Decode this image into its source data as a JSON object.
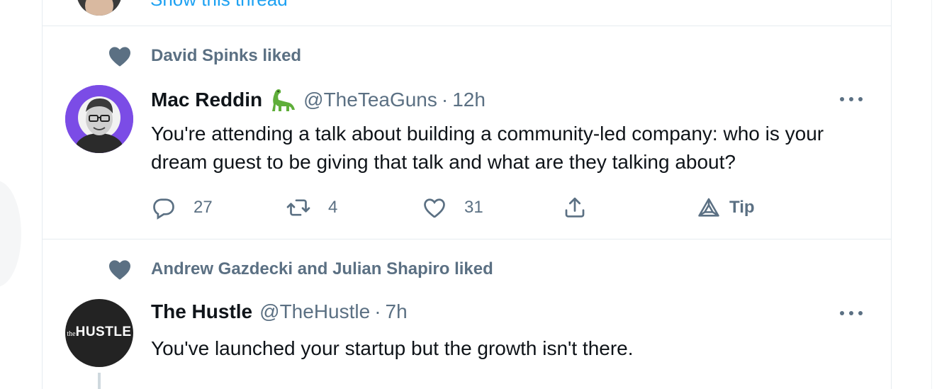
{
  "previous": {
    "show_thread": "Show this thread"
  },
  "tweets": [
    {
      "social_context": "David Spinks liked",
      "name": "Mac Reddin",
      "emoji": "sauropod-icon",
      "handle": "@TheTeaGuns",
      "dot": "·",
      "time": "12h",
      "text": "You're attending a talk about building a community-led company: who is your dream guest to be giving that talk and what are they talking about?",
      "actions": {
        "replies": "27",
        "retweets": "4",
        "likes": "31",
        "tip": "Tip"
      }
    },
    {
      "social_context": "Andrew Gazdecki and Julian Shapiro liked",
      "name": "The Hustle",
      "handle": "@TheHustle",
      "dot": "·",
      "time": "7h",
      "avatar_text_small": "the",
      "avatar_text_big": "HUSTLE",
      "text": "You've launched your startup but the growth isn't there."
    }
  ],
  "colors": {
    "text_primary": "#0f1419",
    "text_secondary": "#5b7083",
    "link": "#1da1f2",
    "border": "#e6ecf0",
    "avatar_purple": "#7b4ce6",
    "hustle_bg": "#232323"
  }
}
